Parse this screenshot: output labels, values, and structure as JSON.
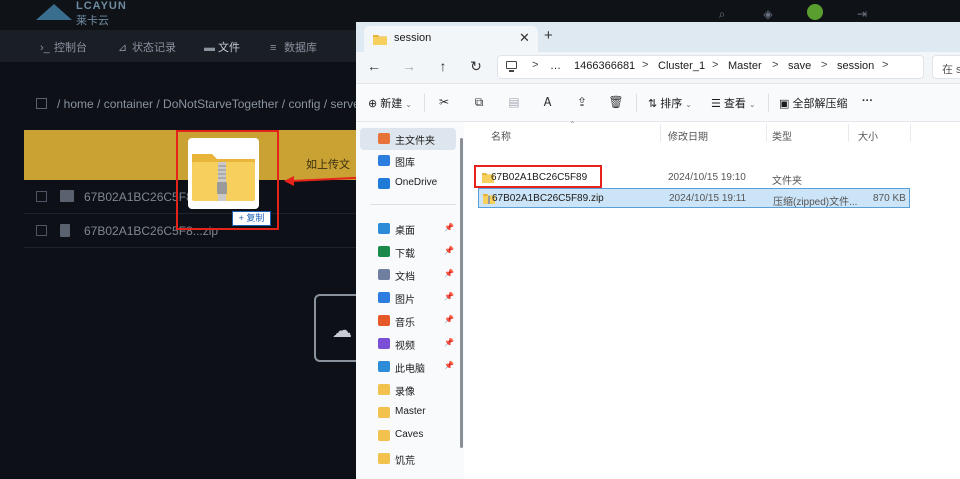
{
  "bg_app": {
    "brand_line1": "LCAYUN",
    "brand_line2": "莱卡云",
    "nav": [
      {
        "icon": "terminal-icon",
        "glyph": "›_",
        "label": "控制台"
      },
      {
        "icon": "chart-icon",
        "glyph": "⊿",
        "label": "状态记录"
      },
      {
        "icon": "folder-icon",
        "glyph": "▬",
        "label": "文件"
      },
      {
        "icon": "database-icon",
        "glyph": "≡",
        "label": "数据库"
      }
    ],
    "path": "/ home / container / DoNotStarveTogether / config / server",
    "banner_text": "如上传文",
    "rows": [
      "67B02A1BC26C5F8",
      "67B02A1BC26C5F8...zip"
    ]
  },
  "drag": {
    "badge_label": "+ 复制"
  },
  "window": {
    "tab_title": "session",
    "tab_close": "✕",
    "new_tab": "+",
    "nav_buttons": {
      "back": "←",
      "forward": "→",
      "up": "↑",
      "refresh": "↻"
    },
    "breadcrumbs": [
      "…",
      "1466366681",
      "Cluster_1",
      "Master",
      "save",
      "session"
    ],
    "crumb_sep": ">",
    "search_placeholder": "在 se",
    "toolbar": {
      "new_label": "新建",
      "sort_label": "排序",
      "view_label": "查看",
      "extract_label": "全部解压缩",
      "more_label": "···"
    }
  },
  "navpane": {
    "items": [
      {
        "label": "主文件夹",
        "icon": "home-icon",
        "color": "#e8733a",
        "pinned": false,
        "selected": true
      },
      {
        "label": "图库",
        "icon": "gallery-icon",
        "color": "#2b7de0",
        "pinned": false,
        "selected": false
      },
      {
        "label": "OneDrive",
        "icon": "cloud-icon",
        "color": "#1f7ad8",
        "pinned": false,
        "selected": false
      },
      {
        "label": "桌面",
        "icon": "desktop-icon",
        "color": "#2d8bd8",
        "pinned": true,
        "selected": false
      },
      {
        "label": "下载",
        "icon": "download-icon",
        "color": "#1a8a4a",
        "pinned": true,
        "selected": false
      },
      {
        "label": "文档",
        "icon": "document-icon",
        "color": "#6f7fa0",
        "pinned": true,
        "selected": false
      },
      {
        "label": "图片",
        "icon": "pictures-icon",
        "color": "#2b7de0",
        "pinned": true,
        "selected": false
      },
      {
        "label": "音乐",
        "icon": "music-icon",
        "color": "#e5582a",
        "pinned": true,
        "selected": false
      },
      {
        "label": "视频",
        "icon": "video-icon",
        "color": "#7a4fd6",
        "pinned": true,
        "selected": false
      },
      {
        "label": "此电脑",
        "icon": "computer-icon",
        "color": "#2d8bd8",
        "pinned": true,
        "selected": false
      },
      {
        "label": "录像",
        "icon": "folder-icon",
        "color": "#f2c14e",
        "pinned": false,
        "selected": false
      },
      {
        "label": "Master",
        "icon": "folder-icon",
        "color": "#f2c14e",
        "pinned": false,
        "selected": false
      },
      {
        "label": "Caves",
        "icon": "folder-icon",
        "color": "#f2c14e",
        "pinned": false,
        "selected": false
      },
      {
        "label": "饥荒",
        "icon": "folder-icon",
        "color": "#f2c14e",
        "pinned": false,
        "selected": false
      }
    ]
  },
  "file_list": {
    "columns": [
      "名称",
      "修改日期",
      "类型",
      "大小"
    ],
    "rows": [
      {
        "name": "67B02A1BC26C5F89",
        "modified": "2024/10/15 19:10",
        "type": "文件夹",
        "size": "",
        "kind": "folder",
        "selected": false
      },
      {
        "name": "67B02A1BC26C5F89.zip",
        "modified": "2024/10/15 19:11",
        "type": "压缩(zipped)文件...",
        "size": "870 KB",
        "kind": "zip",
        "selected": true
      }
    ]
  }
}
